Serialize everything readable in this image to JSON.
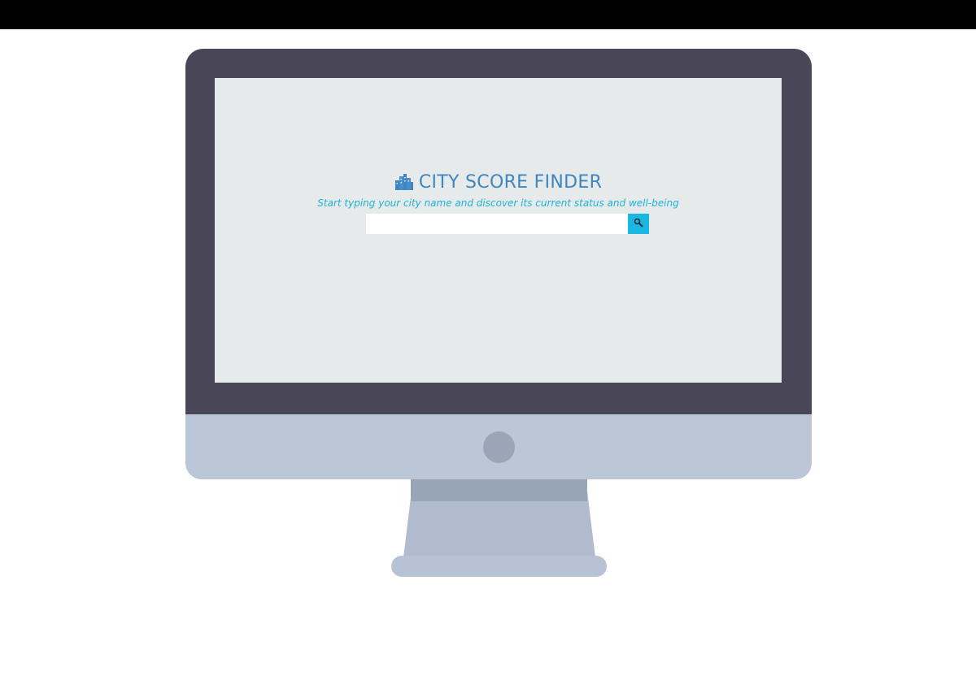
{
  "app": {
    "title": "CITY SCORE FINDER",
    "subtitle": "Start typing your city name and discover its current status and well-being"
  },
  "search": {
    "value": "",
    "placeholder": "",
    "button_icon": "search-icon"
  },
  "icons": {
    "title_icon": "city-icon"
  },
  "colors": {
    "title": "#3f86c1",
    "subtitle": "#1fb2d6",
    "search_button": "#19b8e0",
    "screen_background": "#e6eaeb",
    "bezel": "#494657"
  }
}
